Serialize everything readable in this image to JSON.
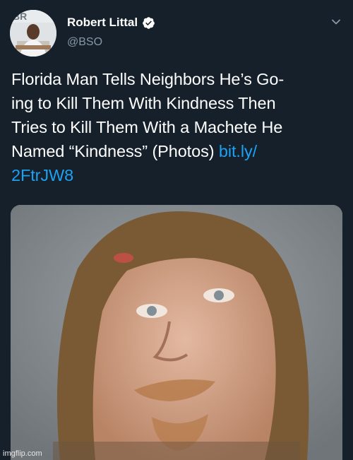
{
  "author": {
    "display_name": "Robert Littal",
    "handle": "@BSO",
    "verified": true,
    "verified_icon": "verified-badge-icon",
    "avatar_description_icon": "avatar-photo"
  },
  "tweet": {
    "text_lines": [
      "Florida Man Tells Neighbors He’s Go-",
      "ing to Kill Them With Kindness Then",
      "Tries to Kill Them With a Machete He",
      "Named “Kindness” (Photos) "
    ],
    "link_part1": "bit.ly/",
    "link_part2": "2FtrJW8"
  },
  "menu": {
    "icon": "chevron-down-icon"
  },
  "media": {
    "type": "photo",
    "icon": "mugshot-photo"
  },
  "watermark": "imgflip.com",
  "colors": {
    "background": "#15202b",
    "text": "#ffffff",
    "secondary_text": "#8899a6",
    "link": "#1da1f2",
    "verified": "#ffffff"
  }
}
